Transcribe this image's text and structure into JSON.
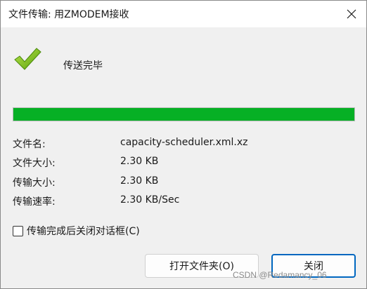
{
  "window": {
    "title": "文件传输: 用ZMODEM接收"
  },
  "status": {
    "text": "传送完毕",
    "icon": "checkmark-icon",
    "progress_percent": 100,
    "progress_color": "#06b025"
  },
  "info": [
    {
      "label": "文件名:",
      "value": "capacity-scheduler.xml.xz"
    },
    {
      "label": "文件大小:",
      "value": "2.30 KB"
    },
    {
      "label": "传输大小:",
      "value": "2.30 KB"
    },
    {
      "label": "传输速率:",
      "value": "2.30 KB/Sec"
    }
  ],
  "options": {
    "close_after_label": "传输完成后关闭对话框(C)",
    "close_after_checked": false
  },
  "buttons": {
    "open_folder": "打开文件夹(O)",
    "close": "关闭"
  },
  "watermark": "CSDN @Redamancy_06"
}
